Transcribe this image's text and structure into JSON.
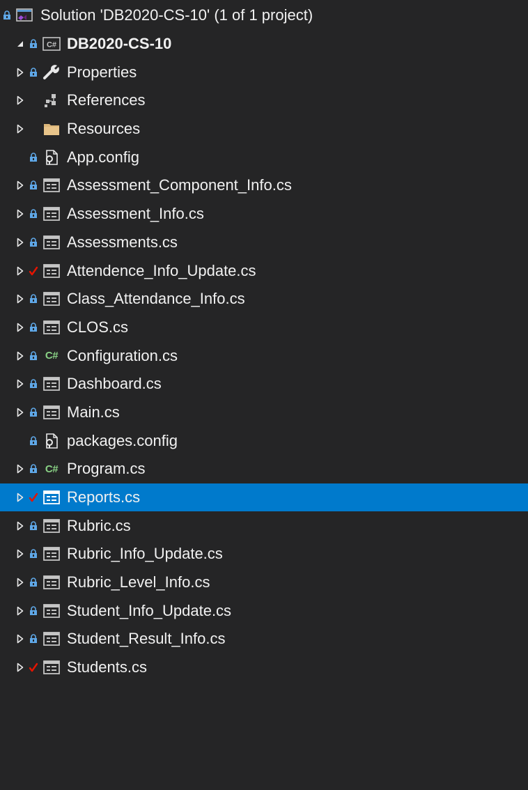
{
  "solution": {
    "label": "Solution 'DB2020-CS-10' (1 of 1 project)",
    "icon": "solution-icon",
    "state": "lock"
  },
  "project": {
    "label": "DB2020-CS-10",
    "icon": "csharp-project-icon",
    "state": "lock",
    "expanded": true
  },
  "items": [
    {
      "label": "Properties",
      "icon": "wrench-icon",
      "state": "lock",
      "expandable": true
    },
    {
      "label": "References",
      "icon": "references-icon",
      "state": "none",
      "expandable": true
    },
    {
      "label": "Resources",
      "icon": "folder-icon",
      "state": "none",
      "expandable": true
    },
    {
      "label": "App.config",
      "icon": "config-file-icon",
      "state": "lock",
      "expandable": false
    },
    {
      "label": "Assessment_Component_Info.cs",
      "icon": "form-icon",
      "state": "lock",
      "expandable": true
    },
    {
      "label": "Assessment_Info.cs",
      "icon": "form-icon",
      "state": "lock",
      "expandable": true
    },
    {
      "label": "Assessments.cs",
      "icon": "form-icon",
      "state": "lock",
      "expandable": true
    },
    {
      "label": "Attendence_Info_Update.cs",
      "icon": "form-icon",
      "state": "check",
      "expandable": true
    },
    {
      "label": "Class_Attendance_Info.cs",
      "icon": "form-icon",
      "state": "lock",
      "expandable": true
    },
    {
      "label": "CLOS.cs",
      "icon": "form-icon",
      "state": "lock",
      "expandable": true
    },
    {
      "label": "Configuration.cs",
      "icon": "csharp-file-icon",
      "state": "lock",
      "expandable": true
    },
    {
      "label": "Dashboard.cs",
      "icon": "form-icon",
      "state": "lock",
      "expandable": true
    },
    {
      "label": "Main.cs",
      "icon": "form-icon",
      "state": "lock",
      "expandable": true
    },
    {
      "label": "packages.config",
      "icon": "config-file-icon",
      "state": "lock",
      "expandable": false
    },
    {
      "label": "Program.cs",
      "icon": "csharp-file-icon",
      "state": "lock",
      "expandable": true
    },
    {
      "label": "Reports.cs",
      "icon": "form-icon",
      "state": "check",
      "expandable": true,
      "selected": true
    },
    {
      "label": "Rubric.cs",
      "icon": "form-icon",
      "state": "lock",
      "expandable": true
    },
    {
      "label": "Rubric_Info_Update.cs",
      "icon": "form-icon",
      "state": "lock",
      "expandable": true
    },
    {
      "label": "Rubric_Level_Info.cs",
      "icon": "form-icon",
      "state": "lock",
      "expandable": true
    },
    {
      "label": "Student_Info_Update.cs",
      "icon": "form-icon",
      "state": "lock",
      "expandable": true
    },
    {
      "label": "Student_Result_Info.cs",
      "icon": "form-icon",
      "state": "lock",
      "expandable": true
    },
    {
      "label": "Students.cs",
      "icon": "form-icon",
      "state": "check",
      "expandable": true
    }
  ],
  "csharp_glyph": "C#",
  "colors": {
    "background": "#252526",
    "selection": "#007acc",
    "text": "#f1f1f1",
    "lock": "#5fa8e8",
    "check": "#e51400",
    "folder": "#dcb67a",
    "csharp": "#89d185"
  }
}
